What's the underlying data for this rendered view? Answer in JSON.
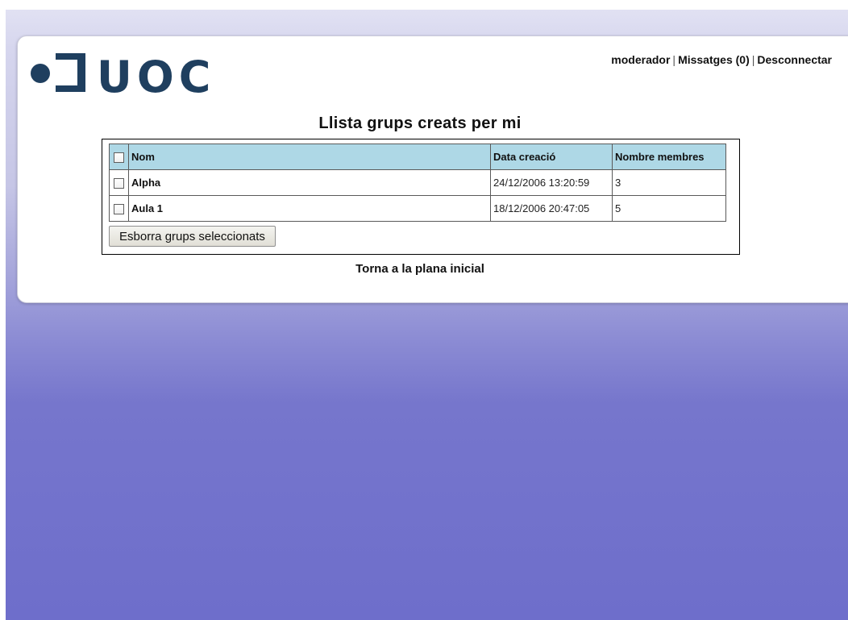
{
  "logo": {
    "text": "UOC",
    "color": "#1f3f5f"
  },
  "header_links": {
    "user": "moderador",
    "messages": "Missatges (0)",
    "logout": "Desconnectar",
    "separator": "|"
  },
  "page_title": "Llista grups creats per mi",
  "table": {
    "headers": {
      "name": "Nom",
      "date": "Data creació",
      "members": "Nombre membres"
    },
    "rows": [
      {
        "name": "Alpha",
        "date": "24/12/2006 13:20:59",
        "members": "3"
      },
      {
        "name": "Aula 1",
        "date": "18/12/2006 20:47:05",
        "members": "5"
      }
    ],
    "header_bg": "#aed8e6"
  },
  "delete_button": "Esborra grups seleccionats",
  "home_link": "Torna a la plana inicial"
}
